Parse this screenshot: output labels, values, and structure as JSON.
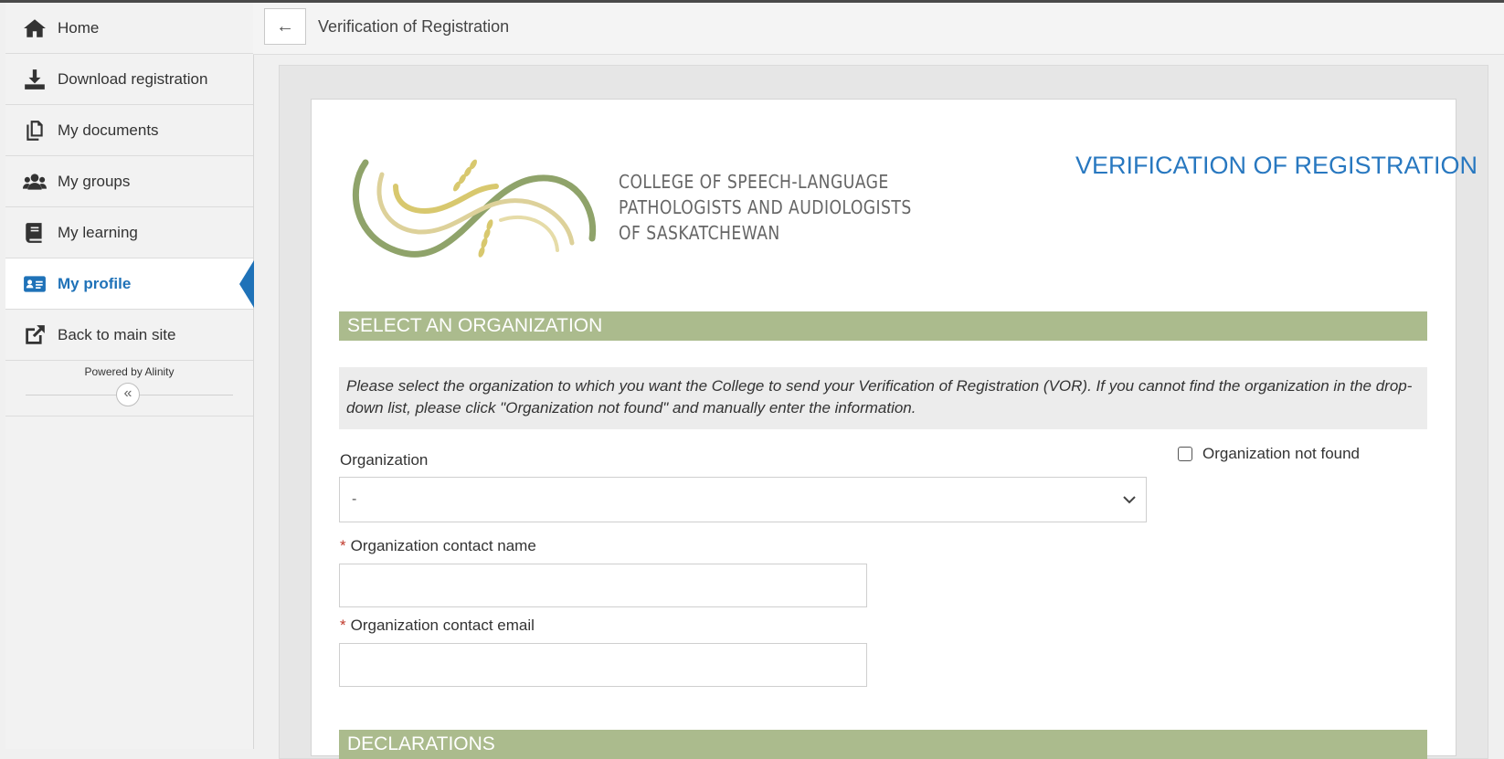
{
  "sidebar": {
    "items": [
      {
        "label": "Home",
        "icon": "home-icon"
      },
      {
        "label": "Download registration",
        "icon": "download-icon"
      },
      {
        "label": "My documents",
        "icon": "documents-icon"
      },
      {
        "label": "My groups",
        "icon": "groups-icon"
      },
      {
        "label": "My learning",
        "icon": "book-icon"
      },
      {
        "label": "My profile",
        "icon": "id-card-icon",
        "active": true
      },
      {
        "label": "Back to main site",
        "icon": "external-link-icon"
      }
    ],
    "powered_by": "Powered by Alinity",
    "collapse_glyph": "«"
  },
  "header": {
    "back_glyph": "←",
    "title": "Verification of Registration"
  },
  "logo": {
    "lines": [
      "College of Speech-Language",
      "Pathologists and Audiologists",
      "of Saskatchewan"
    ]
  },
  "form": {
    "title": "VERIFICATION OF REGISTRATION",
    "section_org": "SELECT AN ORGANIZATION",
    "instructions": "Please select the organization to which you want the College to send your Verification of Registration (VOR). If you cannot find the organization in the drop-down list, please click \"Organization not found\" and manually enter the information.",
    "organization_label": "Organization",
    "organization_value": "-",
    "not_found_label": "Organization not found",
    "not_found_checked": false,
    "required_mark": "*",
    "contact_name_label": "Organization contact name",
    "contact_name_value": "",
    "contact_email_label": "Organization contact email",
    "contact_email_value": "",
    "section_declarations": "DECLARATIONS"
  },
  "colors": {
    "accent": "#1f72b8",
    "section_bar": "#abbb8d",
    "title": "#2878c0",
    "required": "#c0392b",
    "logo_green": "#8fa36a",
    "logo_gold": "#d8c86e"
  }
}
